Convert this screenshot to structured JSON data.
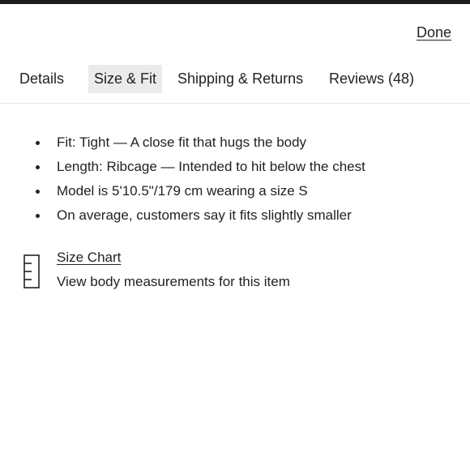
{
  "header": {
    "done_label": "Done"
  },
  "tabs": [
    {
      "label": "Details",
      "active": false
    },
    {
      "label": "Size & Fit",
      "active": true
    },
    {
      "label": "Shipping & Returns",
      "active": false
    },
    {
      "label": "Reviews (48)",
      "active": false
    }
  ],
  "fit_details": [
    "Fit: Tight — A close fit that hugs the body",
    "Length: Ribcage — Intended to hit below the chest",
    "Model is 5'10.5\"/179 cm wearing a size S",
    "On average, customers say it fits slightly smaller"
  ],
  "size_chart": {
    "link_label": "Size Chart",
    "description": "View body measurements for this item",
    "icon": "ruler-icon"
  },
  "colors": {
    "text": "#222222",
    "active_tab_bg": "#ebebeb",
    "top_bar": "#1c1c1c",
    "divider": "#e6e6e6"
  }
}
